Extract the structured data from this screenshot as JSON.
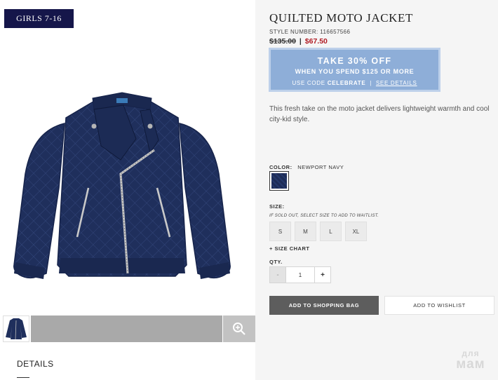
{
  "category": {
    "label": "GIRLS 7-16"
  },
  "product": {
    "title": "QUILTED MOTO JACKET",
    "style_label": "STYLE NUMBER:",
    "style_number": "116657566",
    "original_price": "$135.00",
    "price_separator": "|",
    "sale_price": "$67.50",
    "description": "This fresh take on the moto jacket delivers lightweight warmth and cool city-kid style."
  },
  "promo": {
    "headline": "TAKE 30% OFF",
    "subhead": "WHEN YOU SPEND $125 OR MORE",
    "code_prefix": "USE CODE",
    "code": "CELEBRATE",
    "divider": "|",
    "link": "SEE DETAILS"
  },
  "color": {
    "label": "COLOR:",
    "value": "NEWPORT NAVY",
    "swatch_color": "#1f2f5c"
  },
  "size": {
    "label": "SIZE:",
    "note": "IF SOLD OUT, SELECT SIZE TO ADD TO WAITLIST.",
    "options": [
      "S",
      "M",
      "L",
      "XL"
    ],
    "chart_link": "+ SIZE CHART"
  },
  "qty": {
    "label": "QTY.",
    "minus": "-",
    "value": "1",
    "plus": "+"
  },
  "actions": {
    "add_to_bag": "ADD TO SHOPPING BAG",
    "add_to_wishlist": "ADD TO WISHLIST"
  },
  "gallery": {
    "zoom_icon": "magnifier-plus-icon"
  },
  "tabs": {
    "details": "DETAILS"
  },
  "watermark": {
    "top": "для",
    "bottom": "мам"
  },
  "colors": {
    "badge": "#15164a",
    "promo": "#8eaed8",
    "sale": "#b01c24",
    "jacket": "#1f2f5c",
    "button_dark": "#5d5d5d"
  }
}
